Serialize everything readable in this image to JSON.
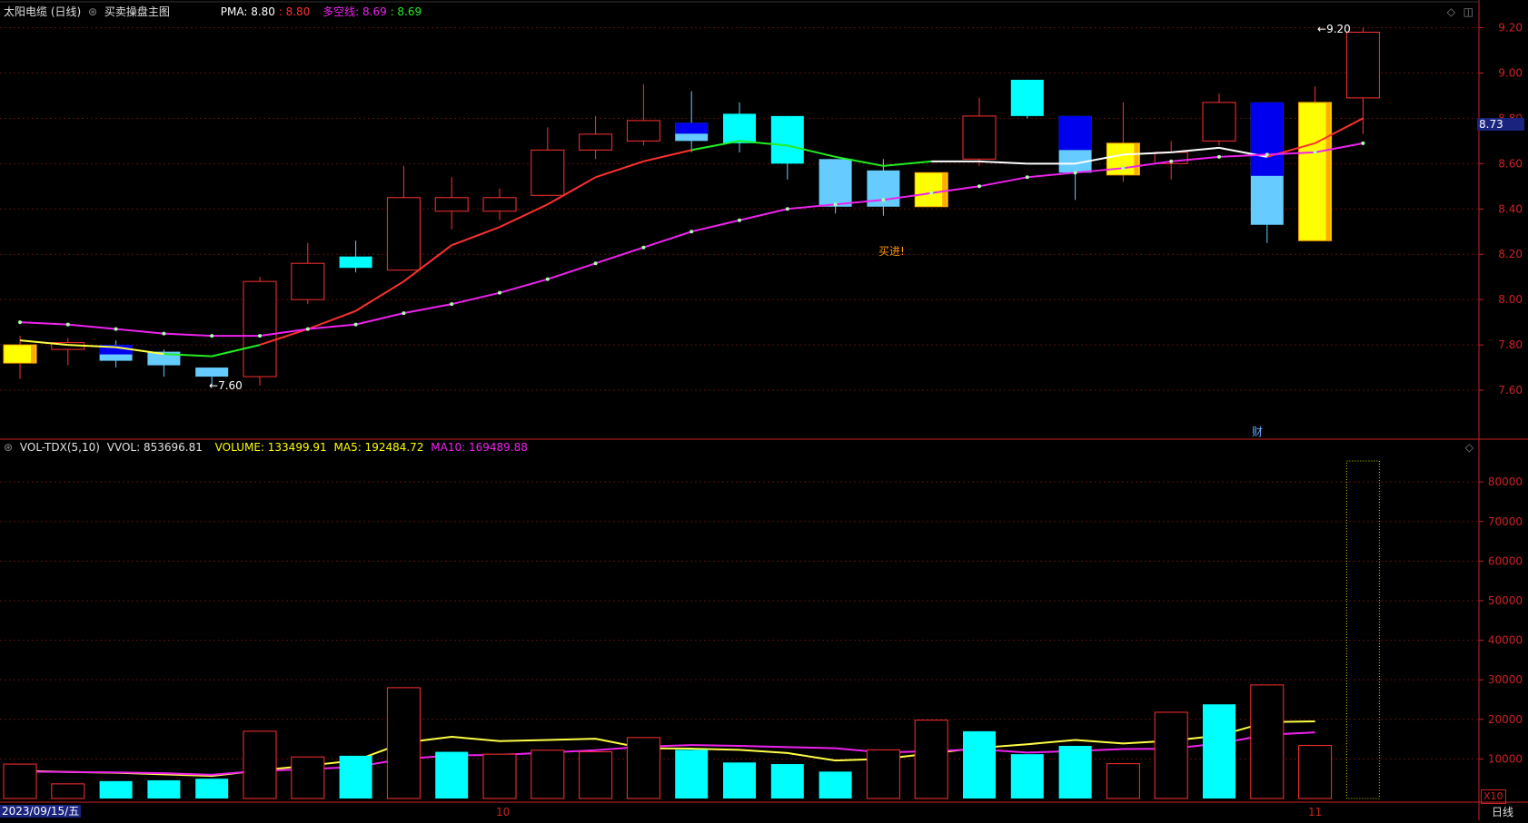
{
  "price_header": {
    "title": "太阳电缆 (日线)",
    "indicator": "买卖操盘主图",
    "pma_label": "PMA: 8.80",
    "pma_value2": ": 8.80",
    "dk_label": "多空线: 8.69",
    "dk_value2": ": 8.69"
  },
  "vol_header": {
    "title": "VOL-TDX(5,10)",
    "vvol": "VVOL: 853696.81",
    "volume": "VOLUME: 133499.91",
    "ma5": "MA5: 192484.72",
    "ma10": "MA10: 169489.88"
  },
  "annotations": {
    "high": "9.20",
    "low": "7.60",
    "buy": "买进!",
    "fin": "财",
    "current": "8.73",
    "x10": "X10",
    "date": "2023/09/15/五",
    "oct": "10",
    "nov": "11",
    "period": "日线"
  },
  "colors": {
    "up": "#ff3030",
    "down_light": "#66ccff",
    "down_cyan": "#00ffff",
    "blue": "#0000ee",
    "yellow": "#ffff00",
    "orange": "#ffaa00",
    "magenta": "#ee22ee",
    "axis": "#cc2222"
  },
  "chart_data": [
    {
      "type": "candlestick",
      "name": "price",
      "ylim": [
        7.4,
        9.25
      ],
      "y_ticks": [
        "9.20",
        "9.00",
        "8.80",
        "8.60",
        "8.40",
        "8.20",
        "8.00",
        "7.80",
        "7.60"
      ],
      "candles": [
        {
          "o": 7.72,
          "h": 7.84,
          "l": 7.65,
          "c": 7.8,
          "style": "yellow"
        },
        {
          "o": 7.78,
          "h": 7.83,
          "l": 7.71,
          "c": 7.81,
          "style": "up"
        },
        {
          "o": 7.8,
          "h": 7.82,
          "l": 7.7,
          "c": 7.73,
          "style": "blue"
        },
        {
          "o": 7.77,
          "h": 7.78,
          "l": 7.66,
          "c": 7.71,
          "style": "light"
        },
        {
          "o": 7.7,
          "h": 7.7,
          "l": 7.62,
          "c": 7.66,
          "style": "light"
        },
        {
          "o": 7.66,
          "h": 8.1,
          "l": 7.62,
          "c": 8.08,
          "style": "up"
        },
        {
          "o": 8.0,
          "h": 8.25,
          "l": 7.98,
          "c": 8.16,
          "style": "up"
        },
        {
          "o": 8.19,
          "h": 8.26,
          "l": 8.12,
          "c": 8.14,
          "style": "cyan"
        },
        {
          "o": 8.13,
          "h": 8.59,
          "l": 8.13,
          "c": 8.45,
          "style": "up"
        },
        {
          "o": 8.39,
          "h": 8.54,
          "l": 8.31,
          "c": 8.45,
          "style": "up"
        },
        {
          "o": 8.39,
          "h": 8.49,
          "l": 8.35,
          "c": 8.45,
          "style": "up"
        },
        {
          "o": 8.46,
          "h": 8.76,
          "l": 8.46,
          "c": 8.66,
          "style": "up"
        },
        {
          "o": 8.66,
          "h": 8.81,
          "l": 8.62,
          "c": 8.73,
          "style": "up"
        },
        {
          "o": 8.7,
          "h": 8.95,
          "l": 8.68,
          "c": 8.79,
          "style": "up"
        },
        {
          "o": 8.78,
          "h": 8.92,
          "l": 8.65,
          "c": 8.7,
          "style": "blue"
        },
        {
          "o": 8.82,
          "h": 8.87,
          "l": 8.65,
          "c": 8.69,
          "style": "cyan"
        },
        {
          "o": 8.81,
          "h": 8.81,
          "l": 8.53,
          "c": 8.6,
          "style": "cyan"
        },
        {
          "o": 8.62,
          "h": 8.62,
          "l": 8.38,
          "c": 8.41,
          "style": "light"
        },
        {
          "o": 8.57,
          "h": 8.62,
          "l": 8.37,
          "c": 8.41,
          "style": "light"
        },
        {
          "o": 8.41,
          "h": 8.56,
          "l": 8.41,
          "c": 8.56,
          "style": "yellow"
        },
        {
          "o": 8.62,
          "h": 8.89,
          "l": 8.59,
          "c": 8.81,
          "style": "up"
        },
        {
          "o": 8.97,
          "h": 8.97,
          "l": 8.8,
          "c": 8.81,
          "style": "cyan"
        },
        {
          "o": 8.81,
          "h": 8.81,
          "l": 8.44,
          "c": 8.56,
          "style": "blue"
        },
        {
          "o": 8.69,
          "h": 8.87,
          "l": 8.52,
          "c": 8.55,
          "style": "yellow"
        },
        {
          "o": 8.6,
          "h": 8.7,
          "l": 8.53,
          "c": 8.65,
          "style": "up"
        },
        {
          "o": 8.7,
          "h": 8.91,
          "l": 8.68,
          "c": 8.87,
          "style": "up"
        },
        {
          "o": 8.87,
          "h": 8.87,
          "l": 8.25,
          "c": 8.33,
          "style": "blue"
        },
        {
          "o": 8.26,
          "h": 8.94,
          "l": 8.26,
          "c": 8.87,
          "style": "yellow"
        },
        {
          "o": 8.89,
          "h": 9.2,
          "l": 8.73,
          "c": 9.18,
          "style": "up"
        }
      ],
      "ma_short": [
        7.82,
        7.8,
        7.79,
        7.76,
        7.75,
        7.8,
        7.87,
        7.95,
        8.08,
        8.24,
        8.32,
        8.42,
        8.54,
        8.61,
        8.66,
        8.7,
        8.68,
        8.63,
        8.59,
        8.61,
        8.61,
        8.6,
        8.6,
        8.64,
        8.65,
        8.67,
        8.63,
        8.69,
        8.8
      ],
      "ma_long": [
        7.9,
        7.89,
        7.87,
        7.85,
        7.84,
        7.84,
        7.87,
        7.89,
        7.94,
        7.98,
        8.03,
        8.09,
        8.16,
        8.23,
        8.3,
        8.35,
        8.4,
        8.42,
        8.44,
        8.47,
        8.5,
        8.54,
        8.56,
        8.58,
        8.61,
        8.63,
        8.64,
        8.65,
        8.69
      ]
    },
    {
      "type": "bar",
      "name": "volume",
      "ylim": [
        0,
        86000
      ],
      "y_ticks": [
        "80000",
        "70000",
        "60000",
        "50000",
        "40000",
        "30000",
        "20000",
        "10000"
      ],
      "values": [
        8700,
        3700,
        4400,
        4600,
        5000,
        17000,
        10500,
        10800,
        28000,
        11800,
        11200,
        12200,
        11800,
        15400,
        12300,
        9100,
        8700,
        6800,
        12300,
        19800,
        17000,
        11200,
        13300,
        8800,
        21800,
        23800,
        28700,
        13400
      ],
      "hollow": [
        true,
        true,
        false,
        false,
        false,
        true,
        true,
        false,
        true,
        false,
        true,
        true,
        true,
        true,
        false,
        false,
        false,
        false,
        true,
        true,
        false,
        false,
        false,
        true,
        true,
        false,
        true,
        true
      ],
      "tail_bar": 85300,
      "ma5": [
        7000,
        6700,
        6500,
        6100,
        5700,
        7100,
        8300,
        9600,
        14100,
        15600,
        14500,
        14800,
        15100,
        12700,
        12600,
        12300,
        11500,
        9600,
        10000,
        11400,
        12800,
        13700,
        14800,
        13900,
        14600,
        15900,
        19300,
        19500
      ],
      "ma10": [
        6800,
        6700,
        6600,
        6400,
        6000,
        7000,
        7400,
        8000,
        10000,
        10900,
        11000,
        11600,
        12200,
        13100,
        13500,
        13300,
        13000,
        12700,
        11600,
        12000,
        12400,
        11600,
        12000,
        12500,
        12600,
        13900,
        16100,
        16700
      ]
    }
  ]
}
